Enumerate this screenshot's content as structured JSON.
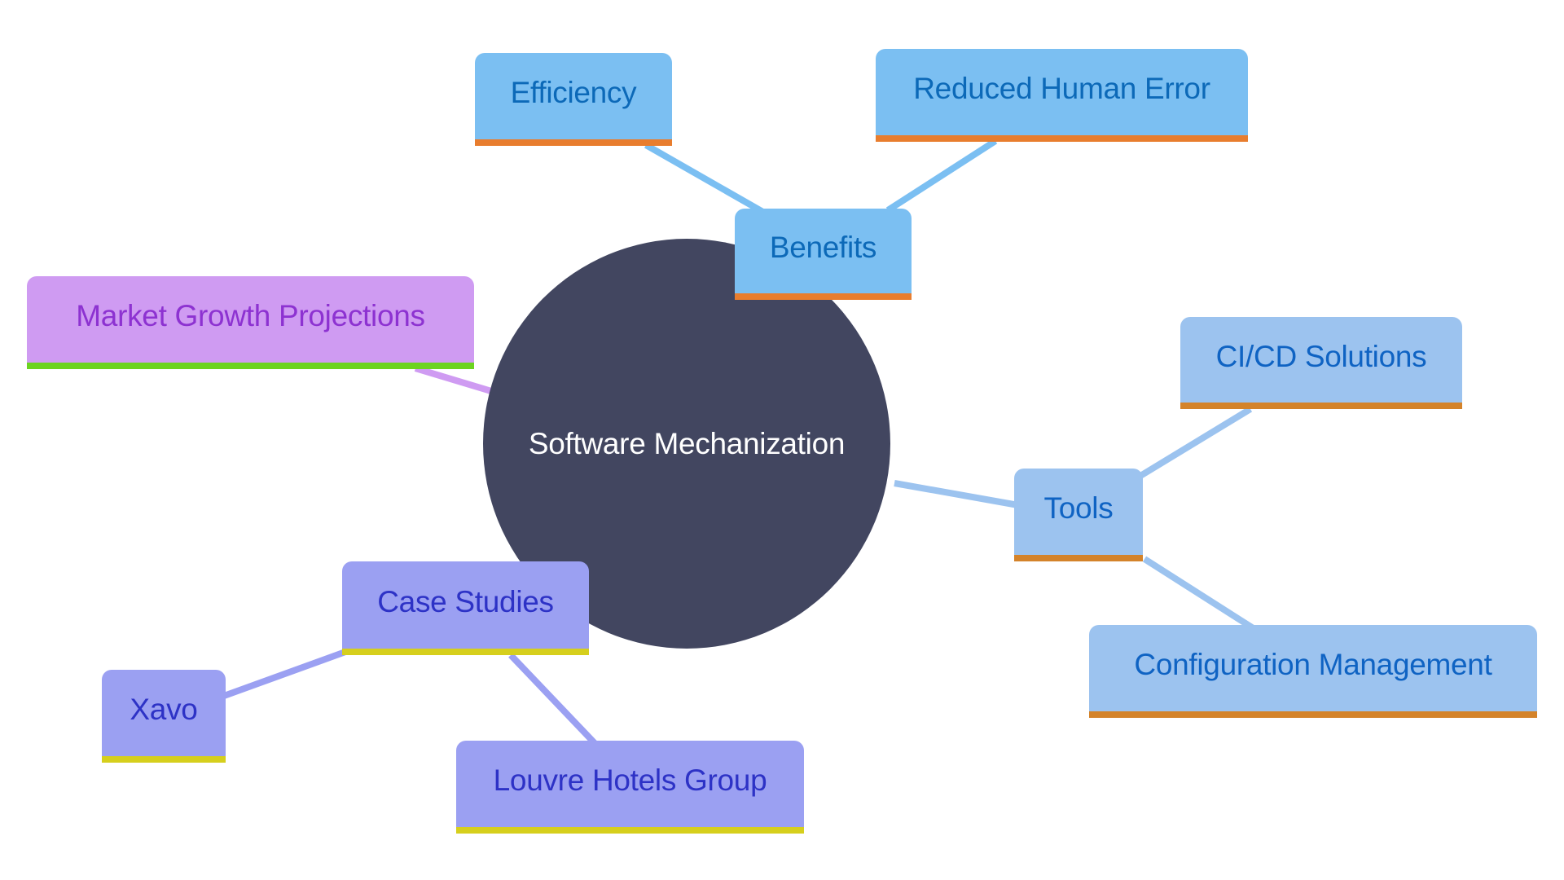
{
  "diagram": {
    "type": "mindmap",
    "root": {
      "label": "Software Mechanization",
      "fill": "#424660",
      "text_color": "#ffffff"
    },
    "branches": [
      {
        "id": "benefits",
        "label": "Benefits",
        "fill": "#7bbff2",
        "text_color": "#0c69b8",
        "accent": "#e87d2e",
        "edge_color": "#7bbff2",
        "children": [
          {
            "id": "efficiency",
            "label": "Efficiency"
          },
          {
            "id": "reduced-human-error",
            "label": "Reduced Human Error"
          }
        ]
      },
      {
        "id": "tools",
        "label": "Tools",
        "fill": "#9cc3ef",
        "text_color": "#0f63c3",
        "accent": "#d4832a",
        "edge_color": "#9cc3ef",
        "children": [
          {
            "id": "ci-cd-solutions",
            "label": "CI/CD Solutions"
          },
          {
            "id": "configuration-management",
            "label": "Configuration Management"
          }
        ]
      },
      {
        "id": "case-studies",
        "label": "Case Studies",
        "fill": "#9ba0f2",
        "text_color": "#2d32c6",
        "accent": "#d6cf1d",
        "edge_color": "#9ba0f2",
        "children": [
          {
            "id": "xavo",
            "label": "Xavo"
          },
          {
            "id": "louvre-hotels-group",
            "label": "Louvre Hotels Group"
          }
        ]
      },
      {
        "id": "market-growth-projections",
        "label": "Market Growth Projections",
        "fill": "#cf9bf2",
        "text_color": "#8d32d1",
        "accent": "#6cd420",
        "edge_color": "#cf9bf2",
        "children": []
      }
    ]
  }
}
